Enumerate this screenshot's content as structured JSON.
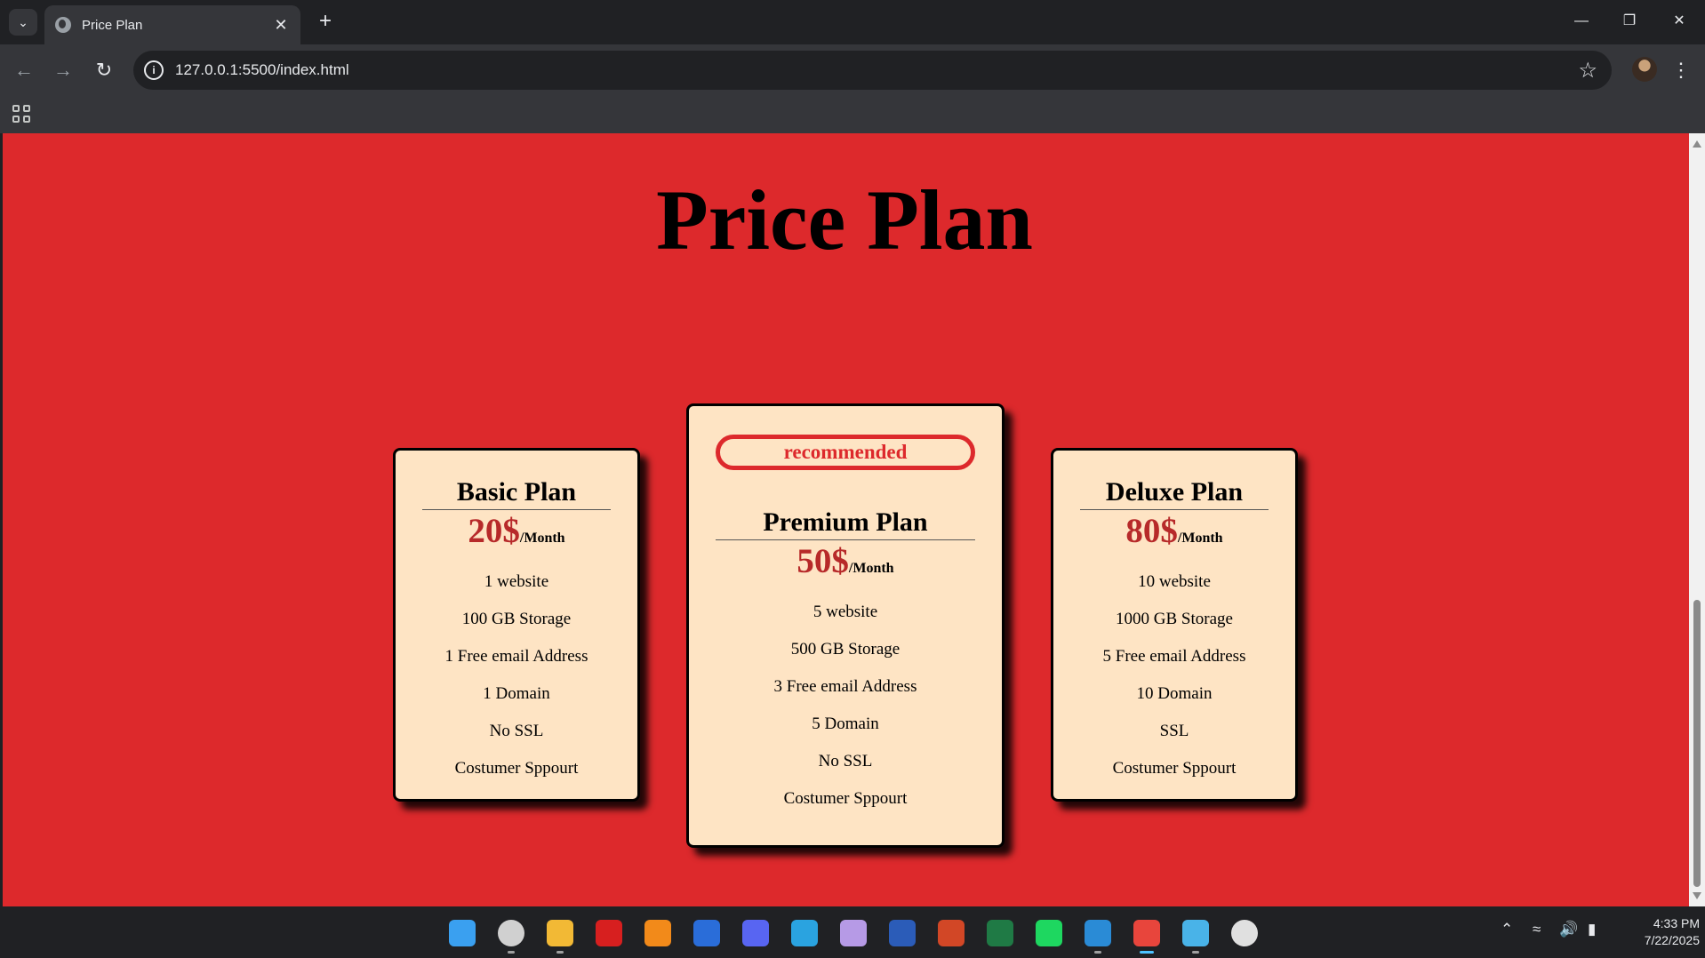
{
  "browser": {
    "tab_title": "Price Plan",
    "tab_close": "✕",
    "new_tab": "+",
    "url": "127.0.0.1:5500/index.html",
    "window_controls": {
      "minimize": "—",
      "restore": "❐",
      "close": "✕"
    }
  },
  "page": {
    "title": "Price Plan",
    "plans": [
      {
        "name": "Basic Plan",
        "price": "20$",
        "period": "/Month",
        "features": [
          "1 website",
          "100 GB Storage",
          "1 Free email Address",
          "1 Domain",
          "No SSL",
          "Costumer Sppourt"
        ]
      },
      {
        "badge": "recommended",
        "name": "Premium Plan",
        "price": "50$",
        "period": "/Month",
        "features": [
          "5 website",
          "500 GB Storage",
          "3 Free email Address",
          "5 Domain",
          "No SSL",
          "Costumer Sppourt"
        ]
      },
      {
        "name": "Deluxe Plan",
        "price": "80$",
        "period": "/Month",
        "features": [
          "10 website",
          "1000 GB Storage",
          "5 Free email Address",
          "10 Domain",
          "SSL",
          "Costumer Sppourt"
        ]
      }
    ]
  },
  "taskbar": {
    "apps": [
      {
        "name": "start-icon",
        "color": "#3aa0f0"
      },
      {
        "name": "search-icon",
        "color": "#d0d0d0"
      },
      {
        "name": "file-explorer-icon",
        "color": "#f2b935"
      },
      {
        "name": "acrobat-icon",
        "color": "#d71f1f"
      },
      {
        "name": "vlc-icon",
        "color": "#f28a1a"
      },
      {
        "name": "css3-icon",
        "color": "#2a6dd9"
      },
      {
        "name": "discord-icon",
        "color": "#5865f2"
      },
      {
        "name": "telegram-icon",
        "color": "#2aa3e0"
      },
      {
        "name": "storage-app-icon",
        "color": "#b69ae6"
      },
      {
        "name": "word-icon",
        "color": "#2b5cb8"
      },
      {
        "name": "powerpoint-icon",
        "color": "#d24726"
      },
      {
        "name": "excel-icon",
        "color": "#1f7a45"
      },
      {
        "name": "spotify-icon",
        "color": "#1ed760"
      },
      {
        "name": "vscode-icon",
        "color": "#2a8bd6"
      },
      {
        "name": "chrome-icon",
        "color": "#e8453c"
      },
      {
        "name": "notepad-icon",
        "color": "#49b3e8"
      },
      {
        "name": "remote-desktop-icon",
        "color": "#e0e0e0"
      }
    ],
    "time": "4:33 PM",
    "date": "7/22/2025"
  }
}
